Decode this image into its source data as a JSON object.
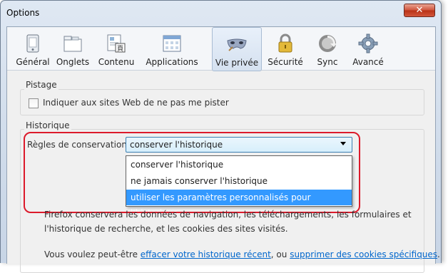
{
  "window": {
    "title": "Options",
    "close_glyph": "✕"
  },
  "toolbar": {
    "items": [
      {
        "label": "Général",
        "icon": "general-icon"
      },
      {
        "label": "Onglets",
        "icon": "tabs-icon"
      },
      {
        "label": "Contenu",
        "icon": "content-icon"
      },
      {
        "label": "Applications",
        "icon": "applications-icon"
      },
      {
        "label": "Vie privée",
        "icon": "privacy-mask-icon"
      },
      {
        "label": "Sécurité",
        "icon": "padlock-icon"
      },
      {
        "label": "Sync",
        "icon": "sync-icon"
      },
      {
        "label": "Avancé",
        "icon": "gear-icon"
      }
    ],
    "selected": "Vie privée"
  },
  "tracking": {
    "group_label": "Pistage",
    "dnt_label": "Indiquer aux sites Web de ne pas me pister",
    "dnt_checked": false
  },
  "history": {
    "group_label": "Historique",
    "rules_label": "Règles de conservation :",
    "selected_value": "conserver l'historique",
    "options": [
      "conserver l'historique",
      "ne jamais conserver l'historique",
      "utiliser les paramètres personnalisés pour l'historique"
    ],
    "highlighted_option": "utiliser les paramètres personnalisés pour l'historique",
    "desc_line1": "Firefox conservera les données de navigation, les téléchargements, les formulaires et",
    "desc_line2": "l'historique de recherche, et les cookies des sites visités.",
    "clear_prefix": "Vous voulez peut-être ",
    "clear_link": "effacer votre historique récent",
    "clear_middle": ", ou ",
    "cookies_link": "supprimer des cookies spécifiques",
    "clear_suffix": "."
  },
  "colors": {
    "annotation_red": "#dc1a2b",
    "selection_blue": "#3399ff",
    "link_blue": "#0066cc"
  }
}
